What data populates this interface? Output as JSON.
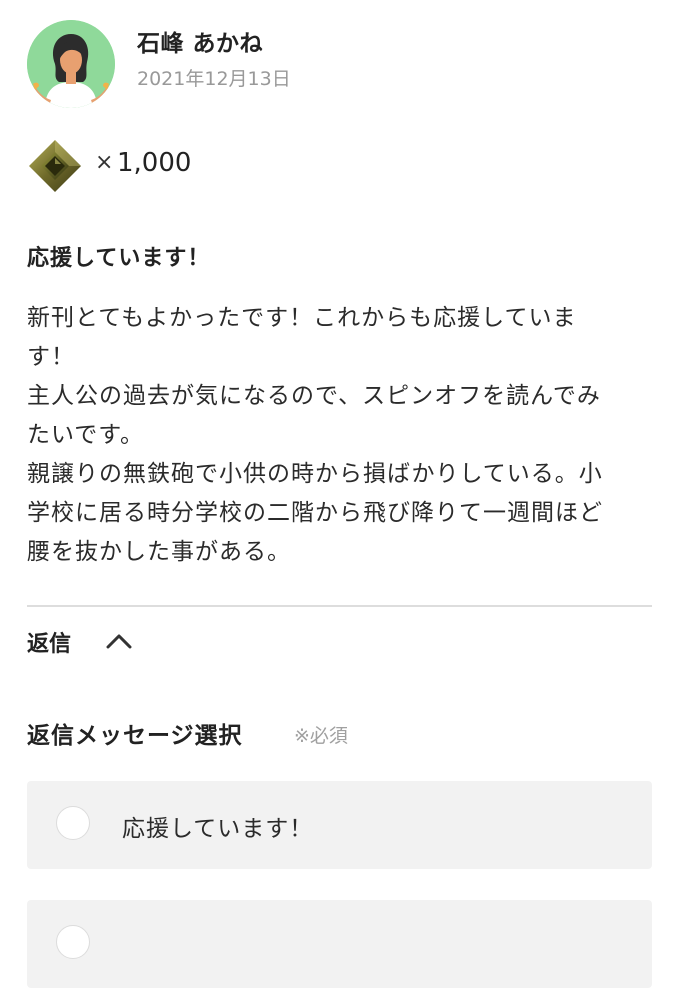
{
  "post": {
    "user_name": "石峰 あかね",
    "date": "2021年12月13日",
    "avatar_icon": "woman-avatar-icon",
    "avatar_bg_color": "#8fd99a"
  },
  "gift": {
    "icon": "gem-item-icon",
    "times": "×",
    "amount": "1,000"
  },
  "message": {
    "title": "応援しています！",
    "lines": [
      "新刊とてもよかったです！これからも応援していま",
      "す！",
      "主人公の過去が気になるので、スピンオフを読んでみ",
      "たいです。",
      "親譲りの無鉄砲で小供の時から損ばかりしている。小",
      "学校に居る時分学校の二階から飛び降りて一週間ほど",
      "腰を抜かした事がある。"
    ]
  },
  "reply": {
    "label": "返信",
    "toggle_icon": "chevron-up-icon",
    "select_title": "返信メッセージ選択",
    "required_note": "※必須",
    "options": [
      {
        "label": "応援しています！"
      },
      {
        "label": ""
      }
    ]
  }
}
